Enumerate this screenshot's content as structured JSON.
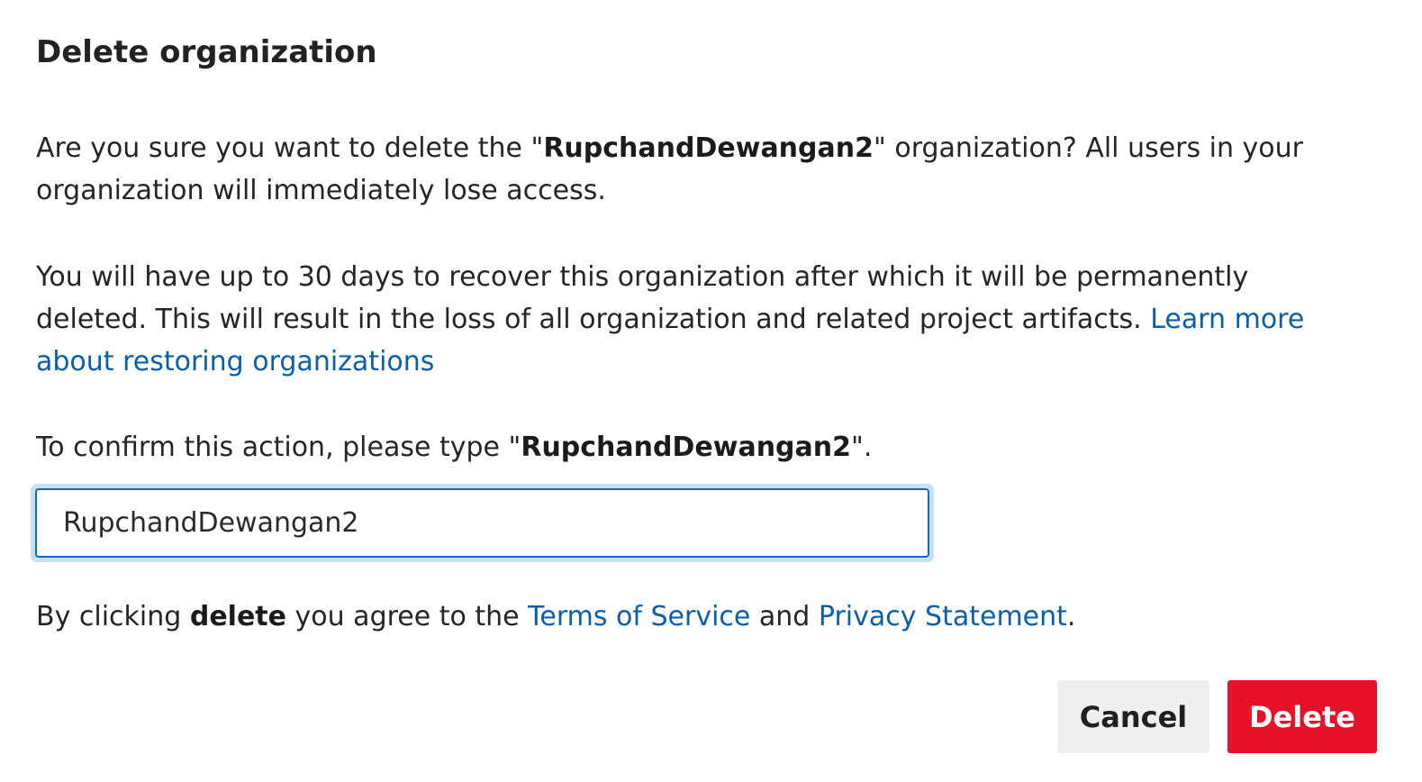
{
  "dialog": {
    "title": "Delete organization",
    "org_name": "RupchandDewangan2",
    "warning": {
      "prefix": "Are you sure you want to delete the \"",
      "suffix": "\" organization? All users in your organization will immediately lose access."
    },
    "recovery": {
      "text": "You will have up to 30 days to recover this organization after which it will be permanently deleted. This will result in the loss of all organization and related project artifacts. ",
      "link_label": "Learn more about restoring organizations"
    },
    "confirm": {
      "prefix": "To confirm this action, please type \"",
      "suffix": "\".",
      "input_value": "RupchandDewangan2"
    },
    "terms": {
      "prefix": "By clicking ",
      "bold_word": "delete",
      "middle": " you agree to the ",
      "terms_link": "Terms of Service",
      "and": " and ",
      "privacy_link": "Privacy Statement",
      "end": "."
    },
    "buttons": {
      "cancel_label": "Cancel",
      "delete_label": "Delete"
    },
    "colors": {
      "link": "#0a5fa8",
      "danger": "#e8112a",
      "focus_border": "#0f6cbd",
      "focus_ring": "#c7e0f4",
      "cancel_bg": "#efefef"
    }
  }
}
